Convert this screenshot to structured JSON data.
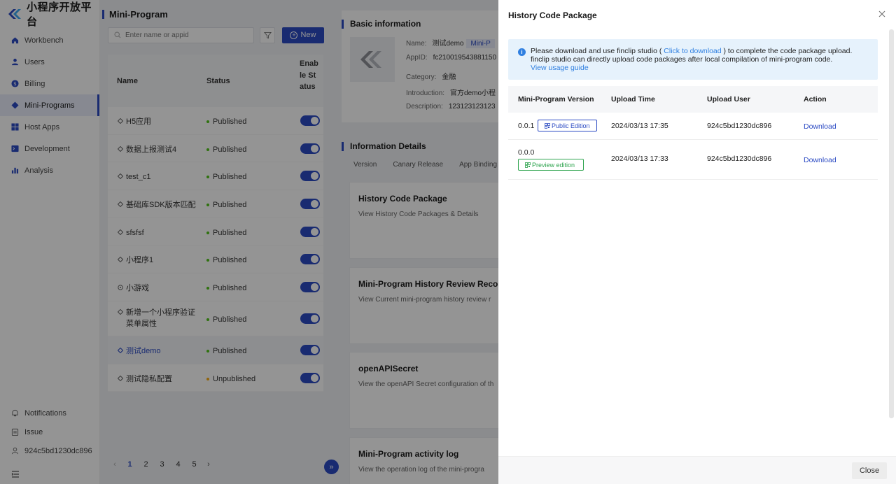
{
  "brand": {
    "name": "小程序开放平台"
  },
  "header": {
    "title": "Mini-Program"
  },
  "nav": {
    "items": [
      {
        "label": "Workbench",
        "icon": "home-icon"
      },
      {
        "label": "Users",
        "icon": "user-icon"
      },
      {
        "label": "Billing",
        "icon": "billing-icon"
      },
      {
        "label": "Mini-Programs",
        "icon": "diamond-icon"
      },
      {
        "label": "Host Apps",
        "icon": "grid-icon"
      },
      {
        "label": "Development",
        "icon": "terminal-icon"
      },
      {
        "label": "Analysis",
        "icon": "bar-chart-icon"
      }
    ],
    "bottom": [
      {
        "label": "Notifications",
        "icon": "bell-icon"
      },
      {
        "label": "Issue",
        "icon": "clipboard-icon"
      },
      {
        "label": "924c5bd1230dc896",
        "icon": "user-outline-icon"
      }
    ]
  },
  "list": {
    "search_placeholder": "Enter name or appid",
    "new_label": "New",
    "columns": {
      "name": "Name",
      "status": "Status",
      "enable": "Enable Status"
    },
    "rows": [
      {
        "name": "H5应用",
        "status": "Published"
      },
      {
        "name": "数据上报测试4",
        "status": "Published"
      },
      {
        "name": "test_c1",
        "status": "Published"
      },
      {
        "name": "基础库SDK版本匹配",
        "status": "Published"
      },
      {
        "name": "sfsfsf",
        "status": "Published"
      },
      {
        "name": "小程序1",
        "status": "Published"
      },
      {
        "name": "小游戏",
        "status": "Published"
      },
      {
        "name": "新增一个小程序验证菜单属性",
        "status": "Published"
      },
      {
        "name": "测试demo",
        "status": "Published"
      },
      {
        "name": "测试隐私配置",
        "status": "Unpublished"
      }
    ],
    "pager": {
      "pages": [
        "1",
        "2",
        "3",
        "4",
        "5"
      ],
      "current": "1"
    }
  },
  "basic": {
    "title": "Basic information",
    "name_label": "Name:",
    "name_value": "测试demo",
    "name_tag": "Mini-P",
    "appid_label": "AppID:",
    "appid_value": "fc210019543881150",
    "category_label": "Category:",
    "category_value": "金融",
    "intro_label": "Introduction:",
    "intro_value": "官方demo小程",
    "desc_label": "Description:",
    "desc_value": "123123123123"
  },
  "details": {
    "title": "Information Details",
    "tabs": [
      "Version",
      "Canary Release",
      "App Binding"
    ],
    "cards": [
      {
        "title": "History Code Package",
        "desc": "View History Code Packages & Details"
      },
      {
        "title": "Mini-Program History Review Records",
        "desc": "View Current mini-program history review r"
      },
      {
        "title": "openAPISecret",
        "desc": "View the openAPI Secret configuration of th"
      },
      {
        "title": "Mini-Program activity log",
        "desc": "View the operation log of the mini-progra"
      }
    ]
  },
  "modal": {
    "title": "History Code Package",
    "info": {
      "p1": "Please download and use finclip studio (",
      "link": "Click to download",
      "p2": ") to complete the code package upload.",
      "line2": "finclip studio can directly upload code packages after local compilation of mini-program code.",
      "guide": "View usage guide"
    },
    "columns": {
      "version": "Mini-Program Version",
      "time": "Upload Time",
      "user": "Upload User",
      "action": "Action"
    },
    "rows": [
      {
        "version": "0.0.1",
        "edition": "Public Edition",
        "time": "2024/03/13 17:35",
        "user": "924c5bd1230dc896",
        "action": "Download"
      },
      {
        "version": "0.0.0",
        "edition": "Preview edition",
        "time": "2024/03/13 17:33",
        "user": "924c5bd1230dc896",
        "action": "Download"
      }
    ],
    "close_label": "Close"
  },
  "colors": {
    "accent": "#2b4ac3",
    "published": "#52c41a",
    "unpublished": "#faad14",
    "preview": "#2fa44f",
    "link": "#2f7fe0"
  }
}
